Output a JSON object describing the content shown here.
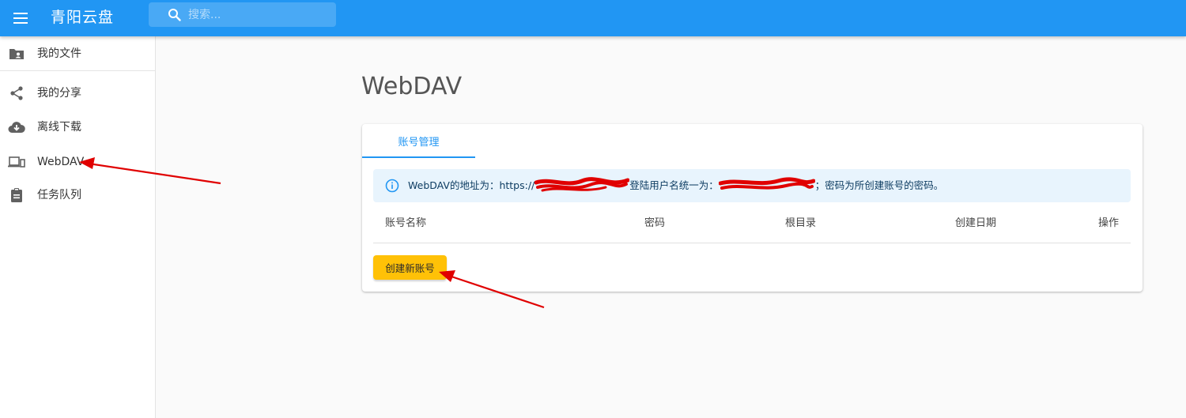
{
  "appbar": {
    "title": "青阳云盘",
    "search_placeholder": "搜索..."
  },
  "sidebar": {
    "items": [
      {
        "label": "我的文件",
        "icon": "folder-account-icon"
      },
      {
        "label": "我的分享",
        "icon": "share-icon"
      },
      {
        "label": "离线下载",
        "icon": "cloud-download-icon"
      },
      {
        "label": "WebDAV",
        "icon": "devices-icon"
      },
      {
        "label": "任务队列",
        "icon": "clipboard-list-icon"
      }
    ]
  },
  "main": {
    "heading": "WebDAV",
    "tab_label": "账号管理",
    "info": {
      "part1": "WebDAV的地址为：https://",
      "part2": "登陆用户名统一为：",
      "part3": "；密码为所创建账号的密码。"
    },
    "table": {
      "columns": [
        "账号名称",
        "密码",
        "根目录",
        "创建日期",
        "操作"
      ]
    },
    "create_button_label": "创建新账号"
  },
  "colors": {
    "primary": "#2196f3",
    "accent": "#ffc107",
    "info_bg": "#e8f4fd",
    "annotation": "#e00000"
  }
}
